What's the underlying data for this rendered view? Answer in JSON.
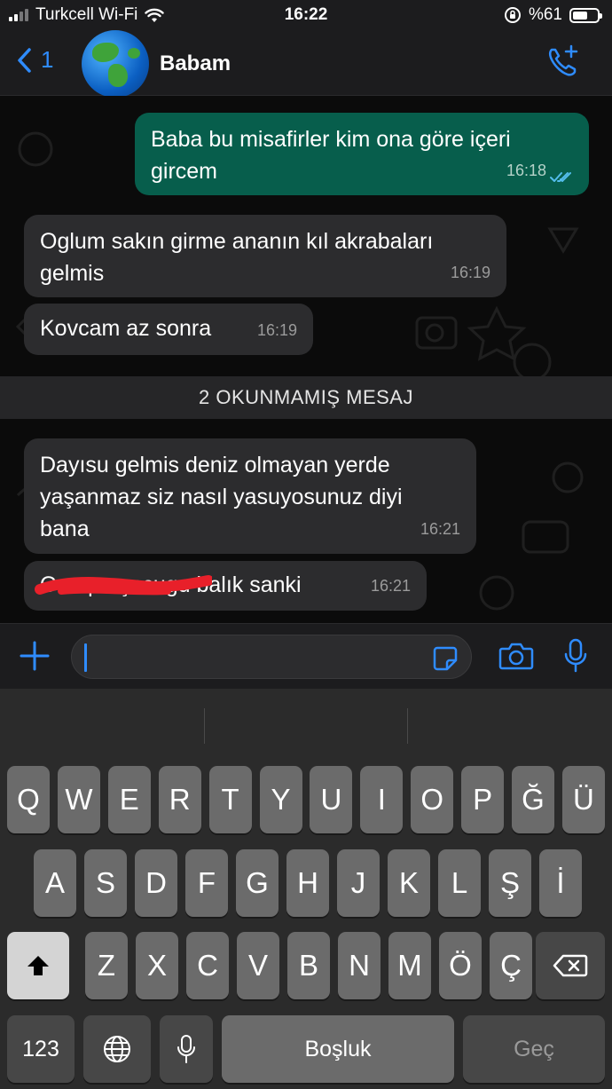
{
  "status_bar": {
    "carrier": "Turkcell Wi-Fi",
    "time": "16:22",
    "battery": "%61",
    "battery_level": 0.61
  },
  "header": {
    "back_count": "1",
    "contact_name": "Babam"
  },
  "messages": [
    {
      "direction": "outgoing",
      "lines": [
        "Baba bu misafirler kim ona göre içeri",
        "gircem"
      ],
      "time": "16:18",
      "read": true
    },
    {
      "direction": "incoming",
      "lines": [
        "Oglum sakın girme ananın kıl akrabaları",
        "gelmis"
      ],
      "time": "16:19"
    },
    {
      "direction": "incoming",
      "lines": [
        "Kovcam az sonra"
      ],
      "time": "16:19"
    },
    {
      "direction": "incoming",
      "lines": [
        "Dayısu gelmis deniz olmayan yerde",
        "yaşanmaz siz nasıl yasuyosunuz diyi",
        "bana"
      ],
      "time": "16:21"
    },
    {
      "direction": "incoming",
      "lines": [
        "Orospu çocugu balık sanki"
      ],
      "time": "16:21",
      "partially_redacted": true
    }
  ],
  "unread_banner": "2 OKUNMAMIŞ MESAJ",
  "keyboard": {
    "row1": [
      "Q",
      "W",
      "E",
      "R",
      "T",
      "Y",
      "U",
      "I",
      "O",
      "P",
      "Ğ",
      "Ü"
    ],
    "row2": [
      "A",
      "S",
      "D",
      "F",
      "G",
      "H",
      "J",
      "K",
      "L",
      "Ş",
      "İ"
    ],
    "row3": [
      "Z",
      "X",
      "C",
      "V",
      "B",
      "N",
      "M",
      "Ö",
      "Ç"
    ],
    "numbers_key": "123",
    "space_key": "Boşluk",
    "return_key": "Geç"
  },
  "icons": [
    "back-chevron-icon",
    "globe-avatar",
    "phone-add-icon",
    "double-check-icon",
    "plus-icon",
    "sticker-icon",
    "camera-icon",
    "microphone-icon",
    "shift-icon",
    "delete-icon",
    "globe-icon",
    "dictation-icon"
  ],
  "colors": {
    "accent": "#2f8cff",
    "outgoing_bubble": "#075e4c",
    "incoming_bubble": "#2c2c2e",
    "read_check": "#53bdeb"
  }
}
